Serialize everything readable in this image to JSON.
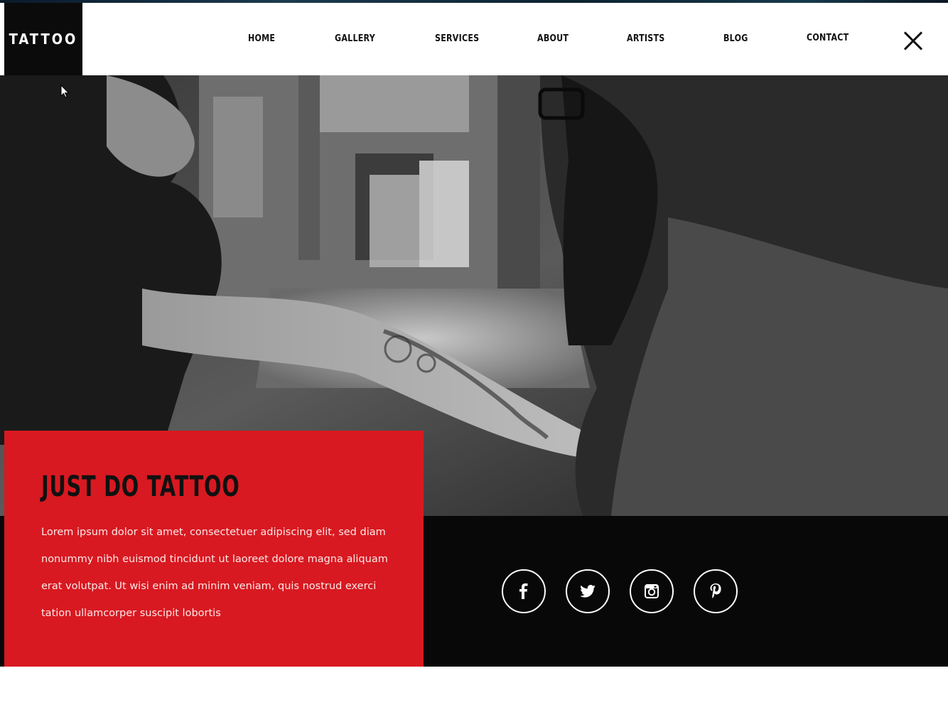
{
  "brand": {
    "logo_text": "TATTOO"
  },
  "nav": {
    "items": [
      {
        "label": "HOME"
      },
      {
        "label": "GALLERY"
      },
      {
        "label": "SERVICES"
      },
      {
        "label": "ABOUT"
      },
      {
        "label": "ARTISTS"
      },
      {
        "label": "BLOG"
      },
      {
        "label": "CONTACT"
      }
    ],
    "close_icon": "close-icon"
  },
  "hero": {
    "image_icon": "tattoo-artist-photo"
  },
  "card": {
    "title": "JUST DO TATTOO",
    "body": "Lorem ipsum dolor sit amet, consectetuer adipiscing elit, sed diam nonummy nibh euismod tincidunt ut laoreet dolore magna aliquam erat volutpat. Ut wisi enim ad minim veniam, quis nostrud exerci tation ullamcorper suscipit lobortis"
  },
  "social": [
    {
      "icon": "facebook-icon"
    },
    {
      "icon": "twitter-icon"
    },
    {
      "icon": "instagram-icon"
    },
    {
      "icon": "pinterest-icon"
    }
  ],
  "colors": {
    "accent": "#d81921",
    "dark": "#080808",
    "logo_bg": "#0b0b0b",
    "text": "#111111"
  }
}
